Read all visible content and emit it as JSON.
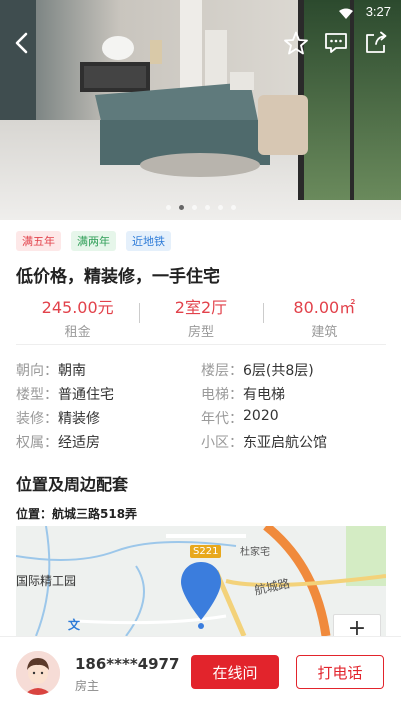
{
  "status": {
    "time": "3:27"
  },
  "hero": {
    "image_count": 6,
    "active_index": 1
  },
  "tags": [
    "满五年",
    "满两年",
    "近地铁"
  ],
  "title": "低价格，精装修，一手住宅",
  "stats": [
    {
      "value": "245.00元",
      "label": "租金"
    },
    {
      "value": "2室2厅",
      "label": "房型"
    },
    {
      "value": "80.00㎡",
      "label": "建筑"
    }
  ],
  "info": [
    [
      {
        "label": "朝向：",
        "value": "朝南"
      },
      {
        "label": "楼层：",
        "value": "6层(共8层)"
      }
    ],
    [
      {
        "label": "楼型：",
        "value": "普通住宅"
      },
      {
        "label": "电梯：",
        "value": "有电梯"
      }
    ],
    [
      {
        "label": "装修：",
        "value": "精装修"
      },
      {
        "label": "年代：",
        "value": "2020"
      }
    ],
    [
      {
        "label": "权属：",
        "value": "经适房"
      },
      {
        "label": "小区：",
        "value": "东亚启航公馆"
      }
    ]
  ],
  "location": {
    "title": "位置及周边配套",
    "address": "位置：航城三路518弄"
  },
  "map": {
    "labels": {
      "park": "国际精工园",
      "village": "杜家宅",
      "road": "航城路",
      "highway": "S221",
      "wen": "文"
    },
    "zoom_in": "+"
  },
  "owner": {
    "phone": "186****4977",
    "role": "房主"
  },
  "buttons": {
    "chat": "在线问",
    "call": "打电话"
  },
  "colors": {
    "accent": "#e2242c",
    "tag_red": "#e2424b",
    "tag_green": "#2f9e57",
    "tag_blue": "#2d7bd8"
  },
  "icons": [
    "back-icon",
    "star-icon",
    "message-icon",
    "share-icon",
    "location-pin-icon",
    "wifi-icon"
  ]
}
